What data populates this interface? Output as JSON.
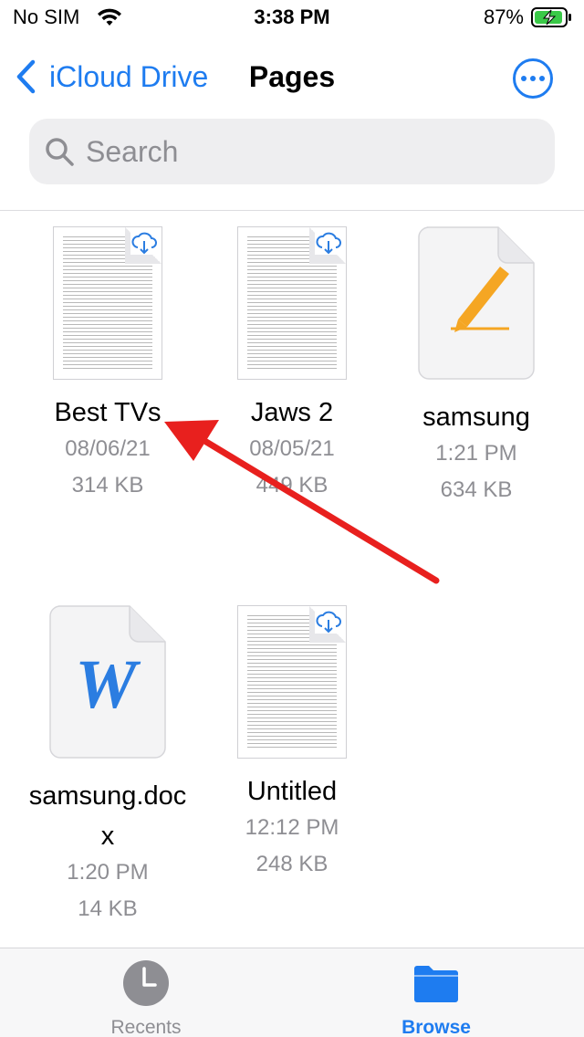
{
  "status_bar": {
    "carrier": "No SIM",
    "time": "3:38 PM",
    "battery": "87%"
  },
  "nav": {
    "back_label": "iCloud Drive",
    "title": "Pages",
    "more_icon": "ellipsis-circle-icon"
  },
  "search": {
    "placeholder": "Search",
    "value": ""
  },
  "files": [
    {
      "name": "Best TVs",
      "date": "08/06/21",
      "size": "314 KB",
      "type": "document",
      "in_cloud": true
    },
    {
      "name": "Jaws 2",
      "date": "08/05/21",
      "size": "449 KB",
      "type": "document",
      "in_cloud": true
    },
    {
      "name": "samsung",
      "date": "1:21 PM",
      "size": "634 KB",
      "type": "pages",
      "in_cloud": false
    },
    {
      "name_line1": "samsung.doc",
      "name_line2": "x",
      "date": "1:20 PM",
      "size": "14 KB",
      "type": "word",
      "in_cloud": false
    },
    {
      "name": "Untitled",
      "date": "12:12 PM",
      "size": "248 KB",
      "type": "document",
      "in_cloud": true
    }
  ],
  "word_icon_letter": "W",
  "tabs": [
    {
      "label": "Recents",
      "icon": "clock-icon",
      "active": false
    },
    {
      "label": "Browse",
      "icon": "folder-icon",
      "active": true
    }
  ],
  "colors": {
    "accent": "#1e7cf0",
    "annotation_arrow": "#e8201e",
    "pages_orange": "#f5a623",
    "word_blue": "#2b7de1"
  }
}
